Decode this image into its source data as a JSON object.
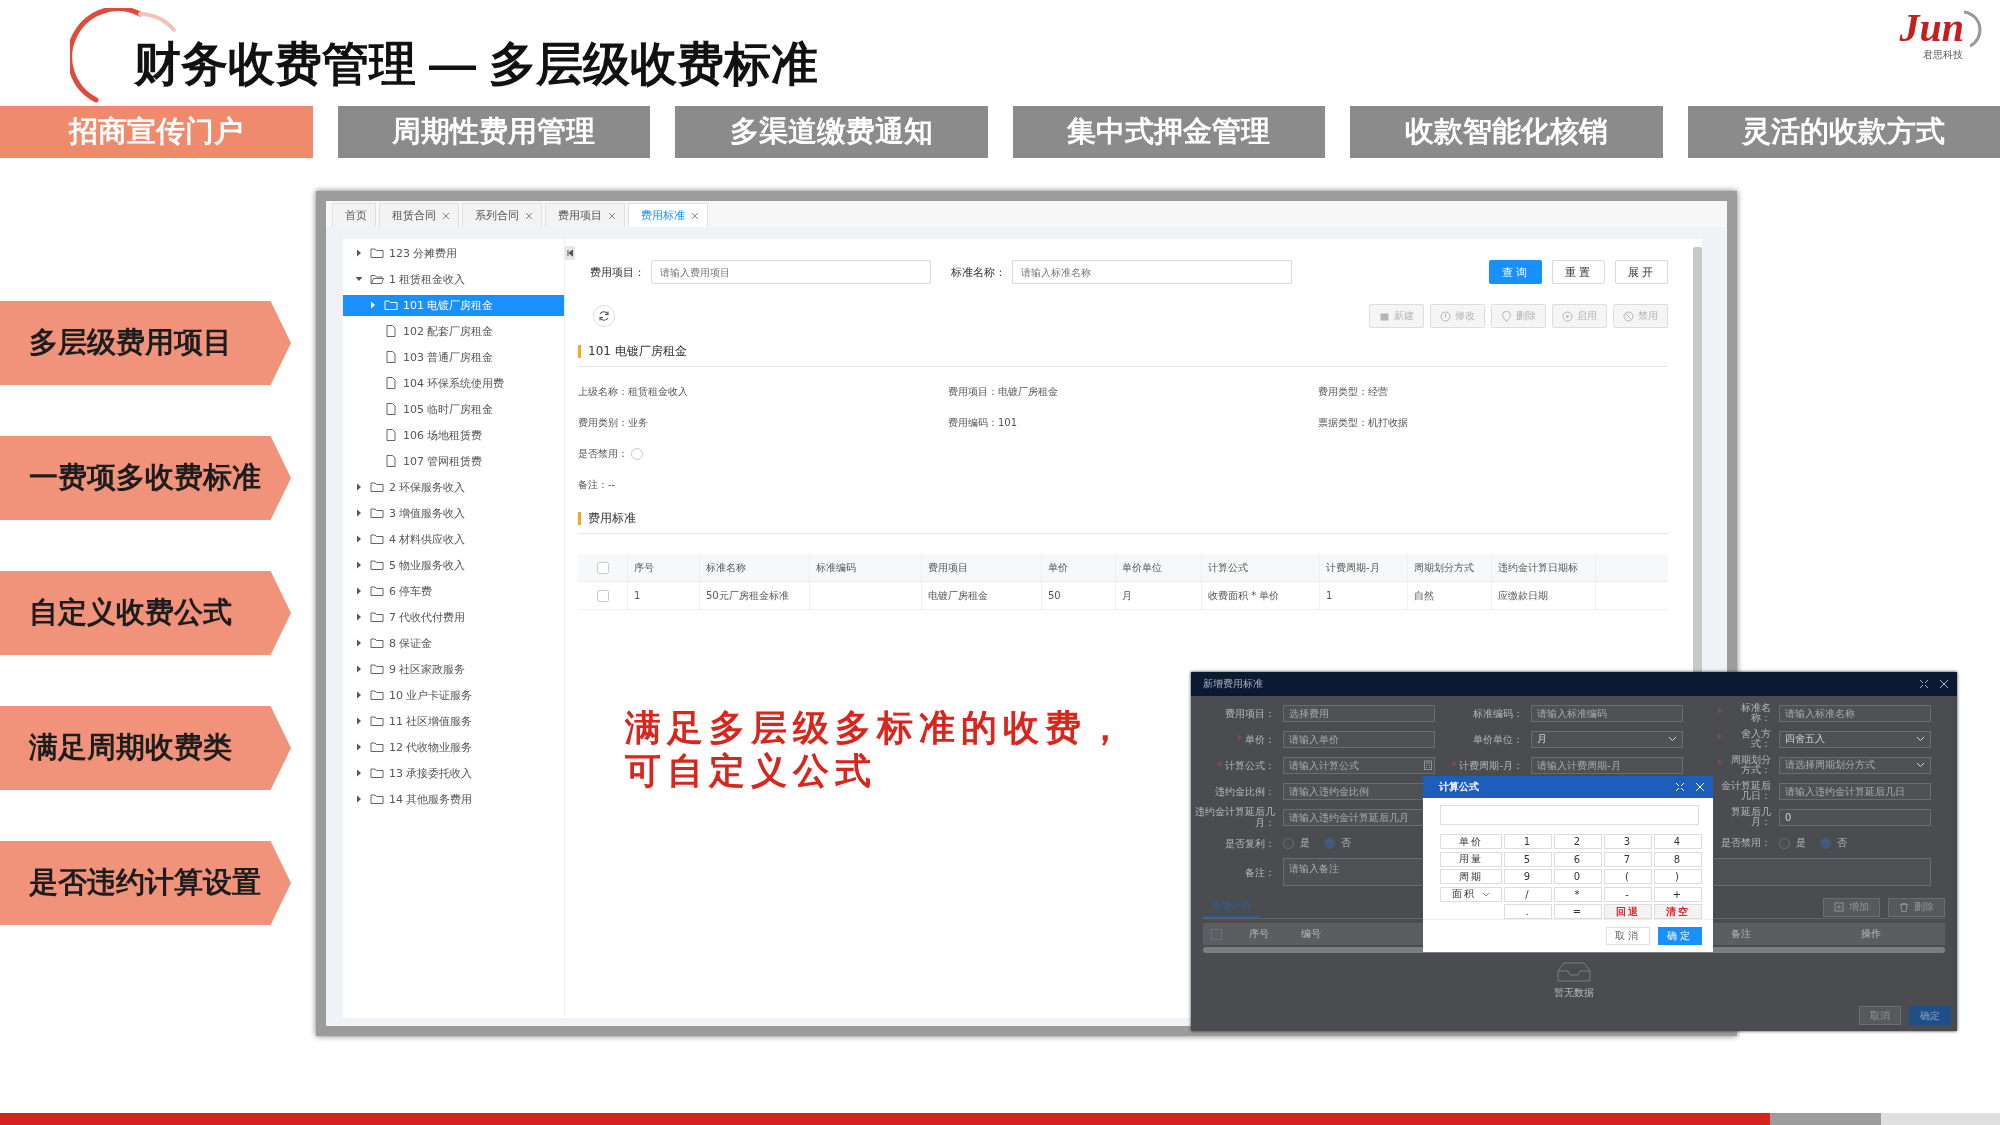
{
  "slide": {
    "title": "财务收费管理 — 多层级收费标准",
    "logo": {
      "text": "Jun",
      "subtitle": "君思科技"
    }
  },
  "feature_tabs": [
    {
      "label": "招商宣传门户",
      "selected": true
    },
    {
      "label": "周期性费用管理",
      "selected": false
    },
    {
      "label": "多渠道缴费通知",
      "selected": false
    },
    {
      "label": "集中式押金管理",
      "selected": false
    },
    {
      "label": "收款智能化核销",
      "selected": false
    },
    {
      "label": "灵活的收款方式",
      "selected": false
    }
  ],
  "side_labels": [
    "多层级费用项目",
    "一费项多收费标准",
    "自定义收费公式",
    "满足周期收费类",
    "是否违约计算设置"
  ],
  "callout": [
    "满足多层级多标准的收费，",
    "可自定义公式"
  ],
  "app": {
    "tabs": [
      {
        "label": "首页",
        "closable": false,
        "selected": false
      },
      {
        "label": "租赁合同",
        "closable": true,
        "selected": false
      },
      {
        "label": "系列合同",
        "closable": true,
        "selected": false
      },
      {
        "label": "费用项目",
        "closable": true,
        "selected": false
      },
      {
        "label": "费用标准",
        "closable": true,
        "selected": true
      }
    ],
    "tree": [
      {
        "label": "123 分摊费用",
        "kind": "folder",
        "expanded": false,
        "selected": false
      },
      {
        "label": "1 租赁租金收入",
        "kind": "folder",
        "expanded": true,
        "selected": false,
        "children": [
          {
            "label": "101 电镀厂房租金",
            "kind": "folder",
            "expanded": false,
            "selected": true
          },
          {
            "label": "102 配套厂房租金",
            "kind": "file",
            "selected": false
          },
          {
            "label": "103 普通厂房租金",
            "kind": "file",
            "selected": false
          },
          {
            "label": "104 环保系统使用费",
            "kind": "file",
            "selected": false
          },
          {
            "label": "105 临时厂房租金",
            "kind": "file",
            "selected": false
          },
          {
            "label": "106 场地租赁费",
            "kind": "file",
            "selected": false
          },
          {
            "label": "107 管网租赁费",
            "kind": "file",
            "selected": false
          }
        ]
      },
      {
        "label": "2 环保服务收入",
        "kind": "folder",
        "expanded": false,
        "selected": false
      },
      {
        "label": "3 增值服务收入",
        "kind": "folder",
        "expanded": false,
        "selected": false
      },
      {
        "label": "4 材料供应收入",
        "kind": "folder",
        "expanded": false,
        "selected": false
      },
      {
        "label": "5 物业服务收入",
        "kind": "folder",
        "expanded": false,
        "selected": false
      },
      {
        "label": "6 停车费",
        "kind": "folder",
        "expanded": false,
        "selected": false
      },
      {
        "label": "7 代收代付费用",
        "kind": "folder",
        "expanded": false,
        "selected": false
      },
      {
        "label": "8 保证金",
        "kind": "folder",
        "expanded": false,
        "selected": false
      },
      {
        "label": "9 社区家政服务",
        "kind": "folder",
        "expanded": false,
        "selected": false
      },
      {
        "label": "10 业户卡证服务",
        "kind": "folder",
        "expanded": false,
        "selected": false
      },
      {
        "label": "11 社区增值服务",
        "kind": "folder",
        "expanded": false,
        "selected": false
      },
      {
        "label": "12 代收物业服务",
        "kind": "folder",
        "expanded": false,
        "selected": false
      },
      {
        "label": "13 承接委托收入",
        "kind": "folder",
        "expanded": false,
        "selected": false
      },
      {
        "label": "14 其他服务费用",
        "kind": "folder",
        "expanded": false,
        "selected": false
      }
    ],
    "search": {
      "fields": [
        {
          "label": "费用项目：",
          "placeholder": "请输入费用项目"
        },
        {
          "label": "标准名称：",
          "placeholder": "请输入标准名称"
        }
      ],
      "buttons": [
        {
          "label": "查询",
          "kind": "primary"
        },
        {
          "label": "重置",
          "kind": "default"
        },
        {
          "label": "展开",
          "kind": "default"
        }
      ]
    },
    "toolbar": [
      {
        "label": "新建",
        "kind": "new",
        "disabled": true
      },
      {
        "label": "修改",
        "kind": "edit",
        "disabled": true
      },
      {
        "label": "删除",
        "kind": "delete",
        "disabled": true
      },
      {
        "label": "启用",
        "kind": "enable",
        "disabled": true
      },
      {
        "label": "禁用",
        "kind": "disable",
        "disabled": true
      }
    ],
    "detail": {
      "title": "101 电镀厂房租金",
      "fields": [
        {
          "label": "上级名称：",
          "value": "租赁租金收入"
        },
        {
          "label": "费用项目：",
          "value": "电镀厂房租金"
        },
        {
          "label": "费用类型：",
          "value": "经营"
        },
        {
          "label": "费用类别：",
          "value": "业务"
        },
        {
          "label": "费用编码：",
          "value": "101"
        },
        {
          "label": "票据类型：",
          "value": "机打收据"
        }
      ],
      "disabled_label": "是否禁用：",
      "disabled_on": false,
      "note_label": "备注：",
      "note": "--"
    },
    "standards": {
      "title": "费用标准",
      "all_checked": false,
      "columns": [
        "序号",
        "标准名称",
        "标准编码",
        "费用项目",
        "单价",
        "单价单位",
        "计算公式",
        "计费周期-月",
        "周期划分方式",
        "违约金计算日期标"
      ],
      "rows": [
        {
          "checked": false,
          "cells": [
            "1",
            "50元厂房租金标准",
            "",
            "电镀厂房租金",
            "50",
            "月",
            "收费面积 * 单价",
            "1",
            "自然",
            "应缴款日期"
          ]
        }
      ]
    }
  },
  "dialog": {
    "title": "新增费用标准",
    "form": [
      {
        "left": {
          "label": "费用项目：",
          "required": false,
          "kind": "input",
          "placeholder": "选择费用"
        },
        "middle": {
          "label": "标准编码：",
          "required": false,
          "kind": "input",
          "placeholder": "请输入标准编码"
        },
        "right": {
          "label": "标准名称：",
          "required": true,
          "kind": "input",
          "placeholder": "请输入标准名称"
        }
      },
      {
        "left": {
          "label": "单价：",
          "required": true,
          "kind": "input",
          "placeholder": "请输入单价"
        },
        "middle": {
          "label": "单价单位：",
          "required": false,
          "kind": "select",
          "value": "月"
        },
        "right": {
          "label": "舍入方式：",
          "required": true,
          "kind": "select",
          "value": "四舍五入"
        }
      },
      {
        "left": {
          "label": "计算公式：",
          "required": true,
          "kind": "formula",
          "placeholder": "请输入计算公式"
        },
        "middle": {
          "label": "计费周期-月：",
          "required": true,
          "kind": "input",
          "placeholder": "请输入计费周期-月"
        },
        "right": {
          "label": "周期划分方式：",
          "required": true,
          "kind": "select",
          "placeholder": "请选择周期划分方式"
        }
      },
      {
        "left": {
          "label": "违约金比例：",
          "required": false,
          "kind": "input",
          "placeholder": "请输入违约金比例"
        },
        "right": {
          "label": "金计算延后几日：",
          "required": false,
          "kind": "input",
          "placeholder": "请输入违约金计算延后几日"
        }
      },
      {
        "left": {
          "label": "违约金计算延后几月：",
          "required": false,
          "kind": "input",
          "placeholder": "请输入违约金计算延后几月"
        },
        "right": {
          "label": "算延后几月：",
          "required": false,
          "kind": "input",
          "value": "0"
        }
      },
      {
        "left": {
          "label": "是否复利：",
          "required": false,
          "kind": "radio",
          "options": [
            {
              "label": "是",
              "selected": false
            },
            {
              "label": "否",
              "selected": true
            }
          ]
        },
        "right": {
          "label": "是否禁用：",
          "required": false,
          "kind": "radio",
          "options": [
            {
              "label": "是",
              "selected": false
            },
            {
              "label": "否",
              "selected": true
            }
          ]
        }
      },
      {
        "full": {
          "label": "备注：",
          "required": false,
          "kind": "textarea",
          "placeholder": "请输入备注"
        }
      }
    ],
    "tabs": [
      {
        "label": "周期计价",
        "selected": true
      }
    ],
    "table_buttons": [
      {
        "label": "增加",
        "kind": "add"
      },
      {
        "label": "删除",
        "kind": "delete"
      }
    ],
    "all_checked": false,
    "columns": [
      "序号",
      "编号",
      "备注",
      "操作"
    ],
    "empty_text": "暂无数据",
    "buttons": [
      {
        "label": "取消",
        "kind": "default"
      },
      {
        "label": "确定",
        "kind": "primary"
      }
    ],
    "calculator": {
      "title": "计算公式",
      "variables": [
        {
          "label": "单价",
          "dropdown": false
        },
        {
          "label": "用量",
          "dropdown": false
        },
        {
          "label": "周期",
          "dropdown": false
        },
        {
          "label": "面积",
          "dropdown": true
        }
      ],
      "keys": [
        {
          "label": "1",
          "kind": "key"
        },
        {
          "label": "2",
          "kind": "key"
        },
        {
          "label": "3",
          "kind": "key"
        },
        {
          "label": "4",
          "kind": "key"
        },
        {
          "label": "5",
          "kind": "key"
        },
        {
          "label": "6",
          "kind": "key"
        },
        {
          "label": "7",
          "kind": "key"
        },
        {
          "label": "8",
          "kind": "key"
        },
        {
          "label": "9",
          "kind": "key"
        },
        {
          "label": "0",
          "kind": "key"
        },
        {
          "label": "(",
          "kind": "key"
        },
        {
          "label": ")",
          "kind": "key"
        },
        {
          "label": "/",
          "kind": "key"
        },
        {
          "label": "*",
          "kind": "key"
        },
        {
          "label": "-",
          "kind": "key"
        },
        {
          "label": "+",
          "kind": "key"
        },
        {
          "label": ".",
          "kind": "key"
        },
        {
          "label": "=",
          "kind": "key"
        },
        {
          "label": "回退",
          "kind": "danger"
        },
        {
          "label": "清空",
          "kind": "danger"
        }
      ],
      "buttons": [
        {
          "label": "取消",
          "kind": "default"
        },
        {
          "label": "确定",
          "kind": "primary"
        }
      ]
    }
  }
}
